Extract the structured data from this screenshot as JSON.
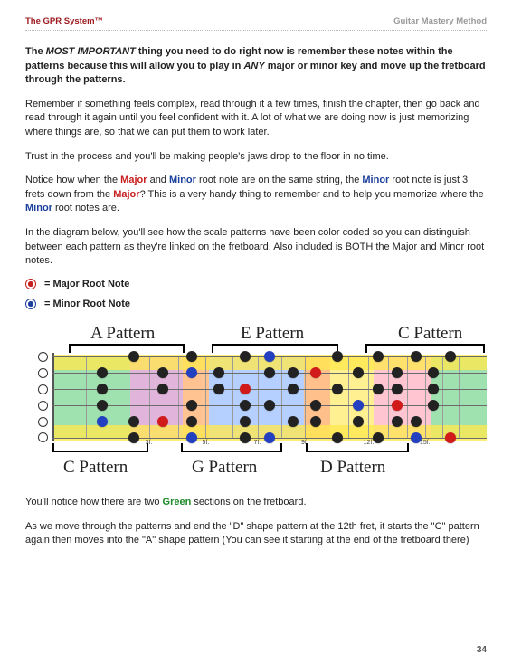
{
  "header": {
    "left": "The GPR System™",
    "right": "Guitar Mastery Method"
  },
  "para1": {
    "t1": "The ",
    "em1": "MOST IMPORTANT",
    "t2": " thing you need to do right now is remember these notes within the patterns because this will allow you to play in ",
    "em2": "ANY",
    "t3": " major or minor key and move up the fretboard through the patterns."
  },
  "para2": "Remember if something feels complex, read through it a few times, finish the chapter, then go back and read through it again until you feel confident with it. A lot of what we are doing now is just memorizing where things are, so that we can put them to work later.",
  "para3": "Trust in the process and you'll be making people's jaws drop to the floor in no time.",
  "para4": {
    "a": "Notice how when the ",
    "major1": "Major",
    "b": " and ",
    "minor1": "Minor",
    "c": " root note are on the same string, the ",
    "minor2": "Minor",
    "d": " root note is just 3 frets down from the ",
    "major2": "Major",
    "e": "? This is a very handy thing to remember and to help you memorize where the ",
    "minor3": "Minor",
    "f": " root notes are."
  },
  "para5": "In the diagram below, you'll see how the scale patterns have been color coded so you can distinguish between each pattern as they're linked on the fretboard. Also included is BOTH the Major and Minor root notes.",
  "legend": {
    "major": "=  Major Root Note",
    "minor": "=  Minor Root Note"
  },
  "diagram": {
    "top_labels": [
      "A Pattern",
      "E Pattern",
      "C Pattern"
    ],
    "bottom_labels": [
      "C Pattern",
      "G Pattern",
      "D Pattern"
    ],
    "fret_labels": [
      "3f.",
      "5f.",
      "7f.",
      "9f.",
      "12f.",
      "15f."
    ]
  },
  "para6": {
    "a": "You'll notice how there are two ",
    "green": "Green",
    "b": " sections on the fretboard."
  },
  "para7": "As we move through the patterns and end the \"D\" shape pattern at the 12th fret, it starts the \"C\" pattern again then moves into the \"A\" shape pattern (You can see it starting at the end of the fretboard there)",
  "footer": {
    "dash": "—",
    "page": " 34"
  }
}
